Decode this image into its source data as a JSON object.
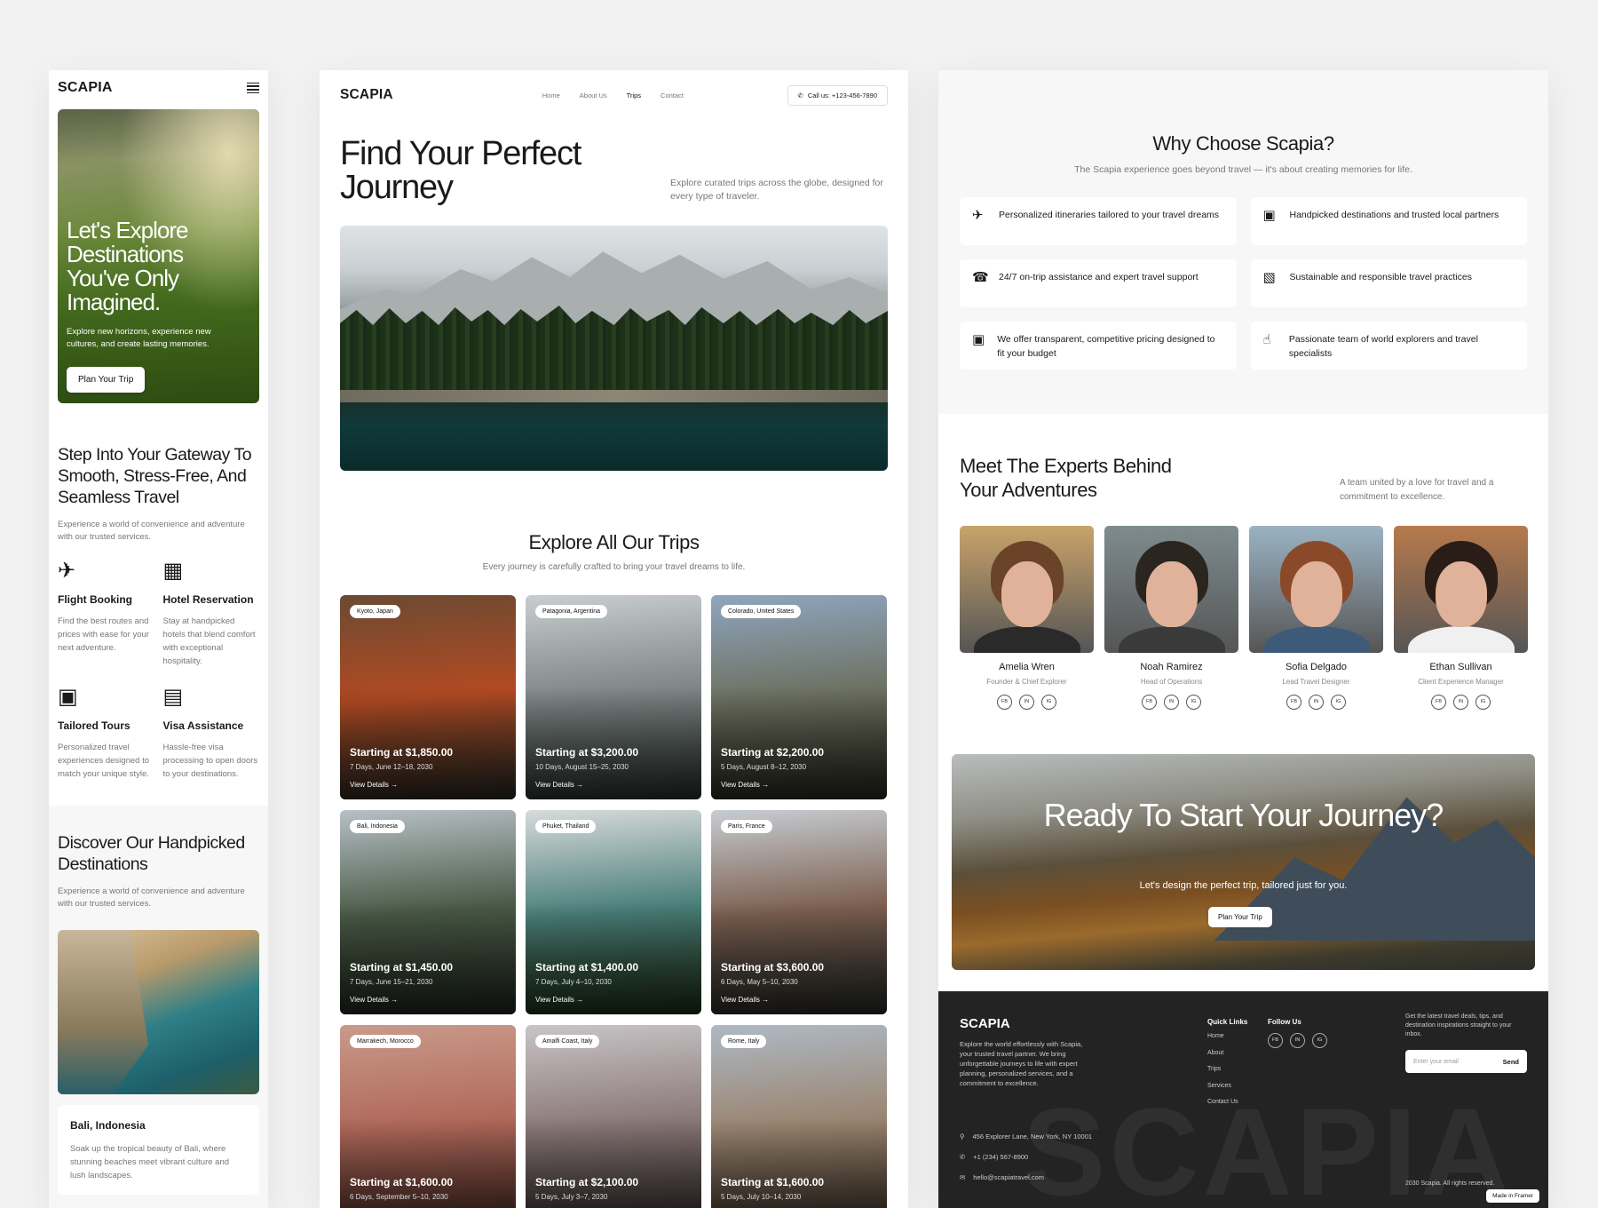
{
  "brand": "SCAPIA",
  "mobile": {
    "hero": {
      "title": "Let's Explore Destinations You've Only Imagined.",
      "text": "Explore new horizons, experience new cultures, and create lasting memories.",
      "button": "Plan Your Trip"
    },
    "gateway": {
      "title": "Step Into Your Gateway To Smooth, Stress-Free, And Seamless Travel",
      "subtitle": "Experience a world of convenience and adventure with our trusted services."
    },
    "services": [
      {
        "icon": "plane-icon",
        "title": "Flight Booking",
        "text": "Find the best routes and prices with ease for your next adventure."
      },
      {
        "icon": "building-icon",
        "title": "Hotel Reservation",
        "text": "Stay at handpicked hotels that blend comfort with exceptional hospitality."
      },
      {
        "icon": "briefcase-icon",
        "title": "Tailored Tours",
        "text": "Personalized travel experiences designed to match your unique style."
      },
      {
        "icon": "passport-icon",
        "title": "Visa Assistance",
        "text": "Hassle-free visa processing to open doors to your destinations."
      }
    ],
    "destinations": {
      "title": "Discover Our Handpicked Destinations",
      "subtitle": "Experience a world of convenience and adventure with our trusted services.",
      "card_title": "Bali, Indonesia",
      "card_text": "Soak up the tropical beauty of Bali, where stunning beaches meet vibrant culture and lush landscapes."
    }
  },
  "desktop": {
    "nav": [
      "Home",
      "About Us",
      "Trips",
      "Contact"
    ],
    "active_nav": "Trips",
    "call": "Call us: +123-456-7890",
    "title": "Find Your Perfect Journey",
    "intro": "Explore curated trips across the globe, designed for every type of traveler.",
    "trips_title": "Explore All Our Trips",
    "trips_subtitle": "Every journey is carefully crafted to bring your travel dreams to life.",
    "view_details": "View Details",
    "trips": [
      {
        "location": "Kyoto, Japan",
        "price": "Starting at $1,850.00",
        "days": "7 Days,",
        "dates": "June 12–18, 2030",
        "colors": [
          "#6b4a32",
          "#b24a22",
          "#3d3a30"
        ]
      },
      {
        "location": "Patagonia, Argentina",
        "price": "Starting at $3,200.00",
        "days": "10 Days,",
        "dates": "August 15–25, 2030",
        "colors": [
          "#c9cdd0",
          "#7c8484",
          "#3e4840"
        ]
      },
      {
        "location": "Colorado, United States",
        "price": "Starting at $2,200.00",
        "days": "5 Days,",
        "dates": "August 8–12, 2030",
        "colors": [
          "#8fa6bf",
          "#6c7060",
          "#3a3a2e"
        ]
      },
      {
        "location": "Bali, Indonesia",
        "price": "Starting at $1,450.00",
        "days": "7 Days,",
        "dates": "June 15–21, 2030",
        "colors": [
          "#b7c0c6",
          "#4a5a46",
          "#2f3a2e"
        ]
      },
      {
        "location": "Phuket, Thailand",
        "price": "Starting at $1,400.00",
        "days": "7 Days,",
        "dates": "July 4–10, 2030",
        "colors": [
          "#d8dadb",
          "#4a7f7a",
          "#2c4524"
        ]
      },
      {
        "location": "Paris, France",
        "price": "Starting at $3,600.00",
        "days": "6 Days,",
        "dates": "May 5–10, 2030",
        "colors": [
          "#c6ccd2",
          "#7d6050",
          "#3b3e3a"
        ]
      },
      {
        "location": "Marrakech, Morocco",
        "price": "Starting at $1,600.00",
        "days": "6 Days,",
        "dates": "September 5–10, 2030",
        "colors": [
          "#c99a8a",
          "#b0685a",
          "#6a4036"
        ]
      },
      {
        "location": "Amalfi Coast, Italy",
        "price": "Starting at $2,100.00",
        "days": "5 Days,",
        "dates": "July 3–7, 2030",
        "colors": [
          "#c8c4c6",
          "#8a7878",
          "#4a4240"
        ]
      },
      {
        "location": "Rome, Italy",
        "price": "Starting at $1,600.00",
        "days": "5 Days,",
        "dates": "July 10–14, 2030",
        "colors": [
          "#aeb9c4",
          "#9a8470",
          "#5a4a3c"
        ]
      }
    ]
  },
  "right": {
    "why_title": "Why Choose Scapia?",
    "why_subtitle": "The Scapia experience goes beyond travel — it's about creating memories for life.",
    "features": [
      {
        "icon": "plane-icon",
        "text": "Personalized itineraries tailored to your travel dreams"
      },
      {
        "icon": "briefcase-icon",
        "text": "Handpicked destinations and trusted local partners"
      },
      {
        "icon": "support-icon",
        "text": "24/7 on-trip assistance and expert travel support"
      },
      {
        "icon": "bus-icon",
        "text": "Sustainable and responsible travel practices"
      },
      {
        "icon": "wallet-icon",
        "text": "We offer transparent, competitive pricing designed to fit your budget"
      },
      {
        "icon": "thumbs-up-icon",
        "text": "Passionate team of world explorers and travel specialists"
      }
    ],
    "team_title": "Meet The Experts  Behind Your Adventures",
    "team_subtitle": "A team united by a love for travel and a commitment to excellence.",
    "team": [
      {
        "name": "Amelia Wren",
        "role": "Founder & Chief Explorer",
        "bg": "#c9a36a",
        "hair": "#6b4328",
        "shirt": "#2a2a2a"
      },
      {
        "name": "Noah Ramirez",
        "role": "Head of Operations",
        "bg": "#7e8c8e",
        "hair": "#2b2520",
        "shirt": "#3a3a3a"
      },
      {
        "name": "Sofia Delgado",
        "role": "Lead Travel Designer",
        "bg": "#9bb3c4",
        "hair": "#8a4a2a",
        "shirt": "#3d5a78"
      },
      {
        "name": "Ethan Sullivan",
        "role": "Client Experience Manager",
        "bg": "#b77a4c",
        "hair": "#2a1c16",
        "shirt": "#f0f0f0"
      }
    ],
    "social_labels": [
      "FB",
      "IN",
      "IG"
    ],
    "cta": {
      "title": "Ready To Start Your Journey?",
      "text": "Let's design the perfect trip, tailored just for you.",
      "button": "Plan Your Trip"
    },
    "footer": {
      "description": "Explore the world effortlessly with Scapia, your trusted travel partner. We bring unforgettable journeys to life with expert planning, personalized services, and a commitment to excellence.",
      "address": "456 Explorer Lane, New York, NY 10001",
      "phone": "+1 (234) 567-8900",
      "email": "hello@scapiatravel.com",
      "quick_links_title": "Quick Links",
      "quick_links": [
        "Home",
        "About",
        "Trips",
        "Services",
        "Contact Us"
      ],
      "follow_title": "Follow Us",
      "newsletter_text": "Get the latest travel deals, tips, and destination inspirations straight to your inbox.",
      "email_placeholder": "Enter your email",
      "send": "Send",
      "copyright": "2030 Scapia. All rights reserved.",
      "watermark": "SCAPIA",
      "framer": "Made in Framer"
    }
  }
}
